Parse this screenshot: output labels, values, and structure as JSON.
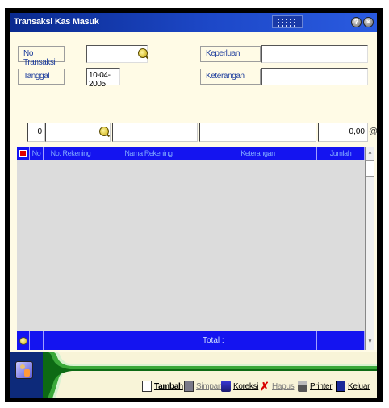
{
  "window": {
    "title": "Transaksi Kas Masuk"
  },
  "form": {
    "no_transaksi_label": "No Transaksi",
    "no_transaksi_value": "",
    "tanggal_label": "Tanggal",
    "tanggal_value": "10-04-2005",
    "keperluan_label": "Keperluan",
    "keperluan_value": "",
    "keterangan_label": "Keterangan",
    "keterangan_value": ""
  },
  "detail": {
    "no_value": "0",
    "jumlah_value": "0,00",
    "at_symbol": "@"
  },
  "grid": {
    "columns": [
      "No",
      "No. Rekening",
      "Nama Rekening",
      "Keterangan",
      "Jumlah"
    ],
    "rows": [],
    "total_label": "Total  :"
  },
  "toolbar": {
    "tambah": "Tambah",
    "simpan": "Simpan",
    "koreksi": "Koreksi",
    "hapus": "Hapus",
    "printer": "Printer",
    "keluar": "Keluar"
  },
  "colors": {
    "grid_header": "#1414f0",
    "title_bar": "#1d48c8",
    "accent_green": "#3aa83a"
  }
}
